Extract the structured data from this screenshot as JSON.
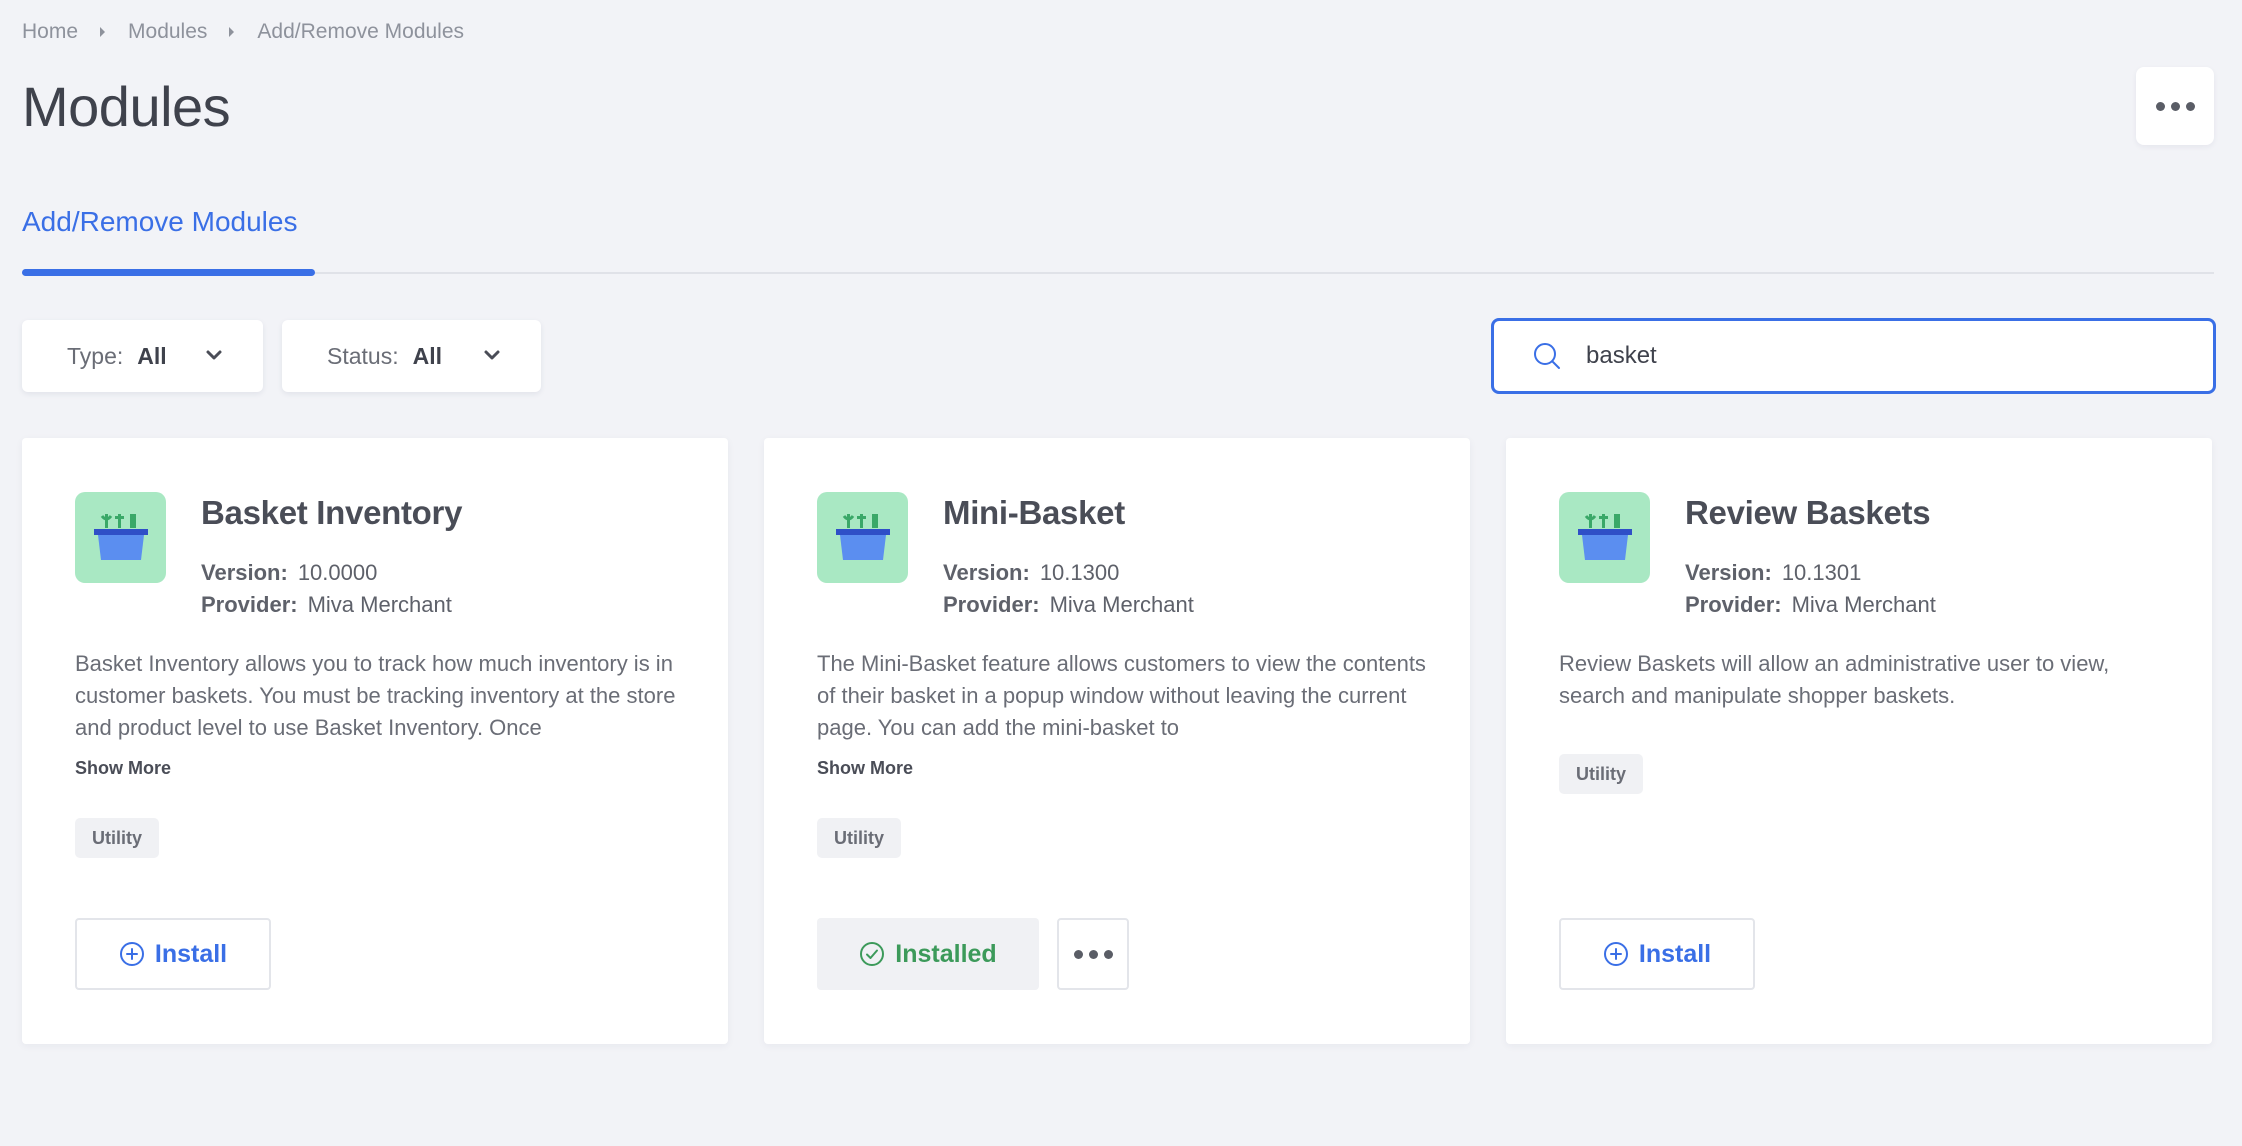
{
  "breadcrumb": [
    "Home",
    "Modules",
    "Add/Remove Modules"
  ],
  "page_title": "Modules",
  "tabs": [
    {
      "label": "Add/Remove Modules",
      "active": true
    }
  ],
  "filters": {
    "type": {
      "label": "Type:",
      "value": "All"
    },
    "status": {
      "label": "Status:",
      "value": "All"
    }
  },
  "search": {
    "value": "basket"
  },
  "version_label": "Version:",
  "provider_label": "Provider:",
  "show_more_label": "Show More",
  "cards": [
    {
      "name": "Basket Inventory",
      "version": "10.0000",
      "provider": "Miva Merchant",
      "description": "Basket Inventory allows you to track how much inventory is in customer baskets. You must be tracking inventory at the store and product level to use Basket Inventory. Once",
      "tag": "Utility",
      "action": "Install"
    },
    {
      "name": "Mini-Basket",
      "version": "10.1300",
      "provider": "Miva Merchant",
      "description": "The Mini-Basket feature allows customers to view the contents of their basket in a popup window without leaving the current page. You can add the mini-basket to",
      "tag": "Utility",
      "action": "Installed"
    },
    {
      "name": "Review Baskets",
      "version": "10.1301",
      "provider": "Miva Merchant",
      "description": "Review Baskets will allow an administrative user to view, search and manipulate shopper baskets.",
      "tag": "Utility",
      "action": "Install"
    }
  ],
  "colors": {
    "accent": "#3a6fe6",
    "installed": "#3c9a5a",
    "logo_bg": "#a9e8c3",
    "background": "#f2f3f7"
  },
  "icons": [
    "chevron-right-icon",
    "more-dots-icon",
    "chevron-down-icon",
    "search-icon",
    "module-basket-icon",
    "plus-circle-icon",
    "check-circle-icon"
  ]
}
